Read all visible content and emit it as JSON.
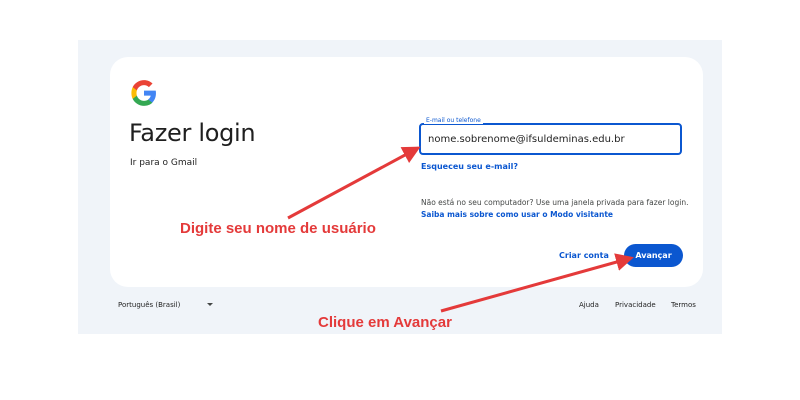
{
  "heading": {
    "title": "Fazer login",
    "subtitle": "Ir para o Gmail"
  },
  "form": {
    "email_label": "E-mail ou telefone",
    "email_value": "nome.sobrenome@ifsuldeminas.edu.br",
    "forgot_email": "Esqueceu seu e-mail?",
    "guest_info": "Não está no seu computador? Use uma janela privada para fazer login.",
    "guest_link": "Saiba mais sobre como usar o Modo visitante",
    "create_account": "Criar conta",
    "next_button": "Avançar"
  },
  "footer": {
    "language": "Português (Brasil)",
    "help": "Ajuda",
    "privacy": "Privacidade",
    "terms": "Termos"
  },
  "annotations": {
    "username_hint": "Digite seu nome de usuário",
    "next_hint": "Clique em Avançar"
  },
  "colors": {
    "accent": "#0b57d0",
    "annotation": "#e43a3a",
    "background": "#f0f4f9"
  },
  "icons": {
    "logo": "google-logo-icon",
    "language_caret": "caret-down-icon"
  }
}
